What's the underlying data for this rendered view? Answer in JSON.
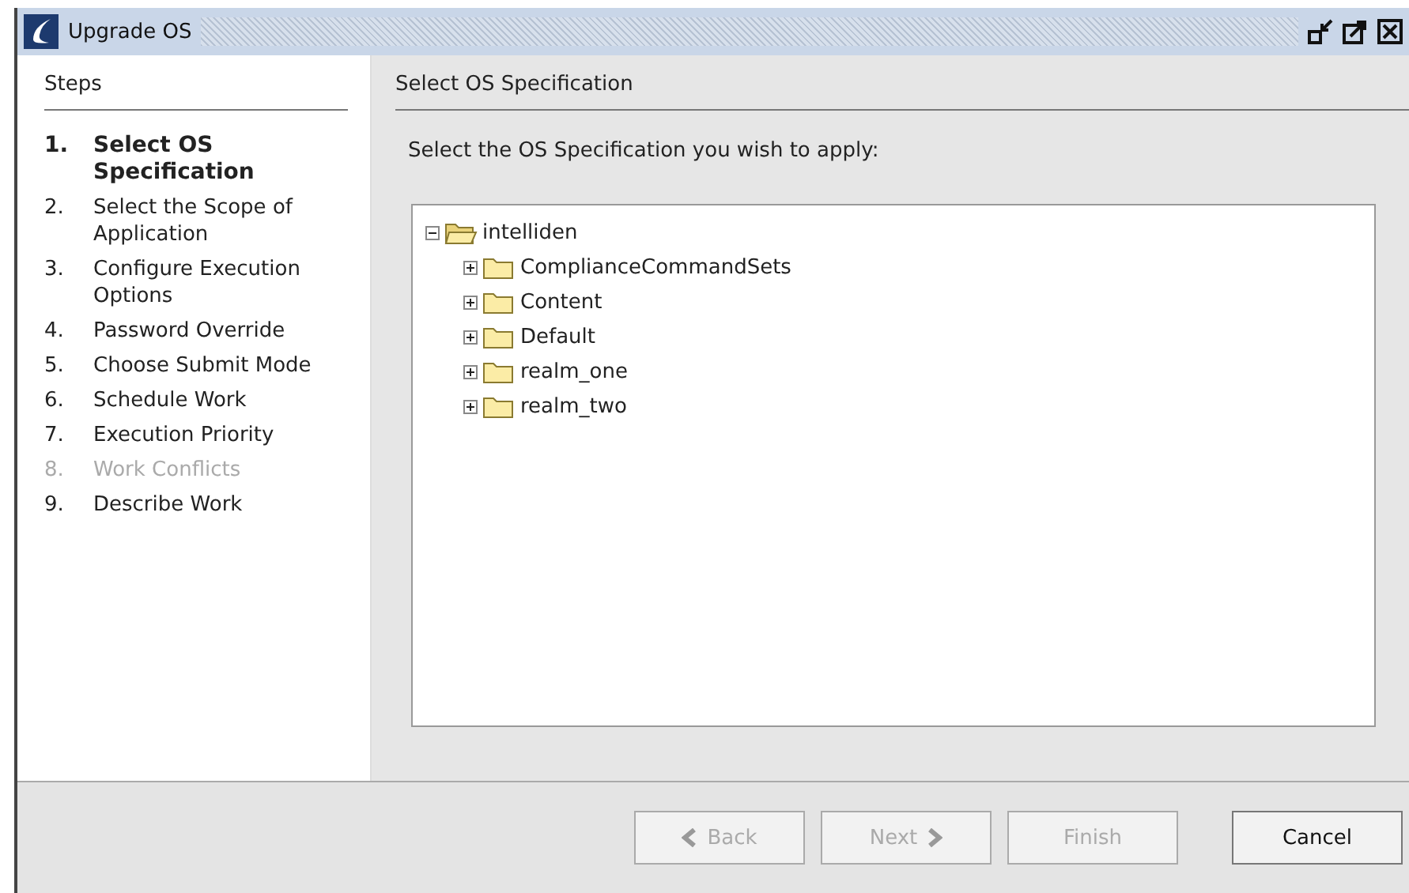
{
  "window": {
    "title": "Upgrade OS"
  },
  "steps": {
    "heading": "Steps",
    "items": [
      {
        "number": "1.",
        "label": "Select OS Specification",
        "selected": true,
        "disabled": false
      },
      {
        "number": "2.",
        "label": "Select the Scope of Application",
        "selected": false,
        "disabled": false
      },
      {
        "number": "3.",
        "label": "Configure Execution Options",
        "selected": false,
        "disabled": false
      },
      {
        "number": "4.",
        "label": "Password Override",
        "selected": false,
        "disabled": false
      },
      {
        "number": "5.",
        "label": "Choose Submit Mode",
        "selected": false,
        "disabled": false
      },
      {
        "number": "6.",
        "label": "Schedule Work",
        "selected": false,
        "disabled": false
      },
      {
        "number": "7.",
        "label": "Execution Priority",
        "selected": false,
        "disabled": false
      },
      {
        "number": "8.",
        "label": "Work Conflicts",
        "selected": false,
        "disabled": true
      },
      {
        "number": "9.",
        "label": "Describe Work",
        "selected": false,
        "disabled": false
      }
    ]
  },
  "content": {
    "heading": "Select OS Specification",
    "prompt": "Select the OS Specification you wish to apply:",
    "tree": [
      {
        "label": "intelliden",
        "expanded": true,
        "children": [
          {
            "label": "ComplianceCommandSets",
            "expanded": false
          },
          {
            "label": "Content",
            "expanded": false
          },
          {
            "label": "Default",
            "expanded": false
          },
          {
            "label": "realm_one",
            "expanded": false
          },
          {
            "label": "realm_two",
            "expanded": false
          }
        ]
      }
    ]
  },
  "buttons": [
    {
      "kind": "back",
      "label": "Back",
      "disabled": true
    },
    {
      "kind": "next",
      "label": "Next",
      "disabled": true
    },
    {
      "kind": "finish",
      "label": "Finish",
      "disabled": true
    },
    {
      "kind": "cancel",
      "label": "Cancel",
      "disabled": false
    }
  ]
}
